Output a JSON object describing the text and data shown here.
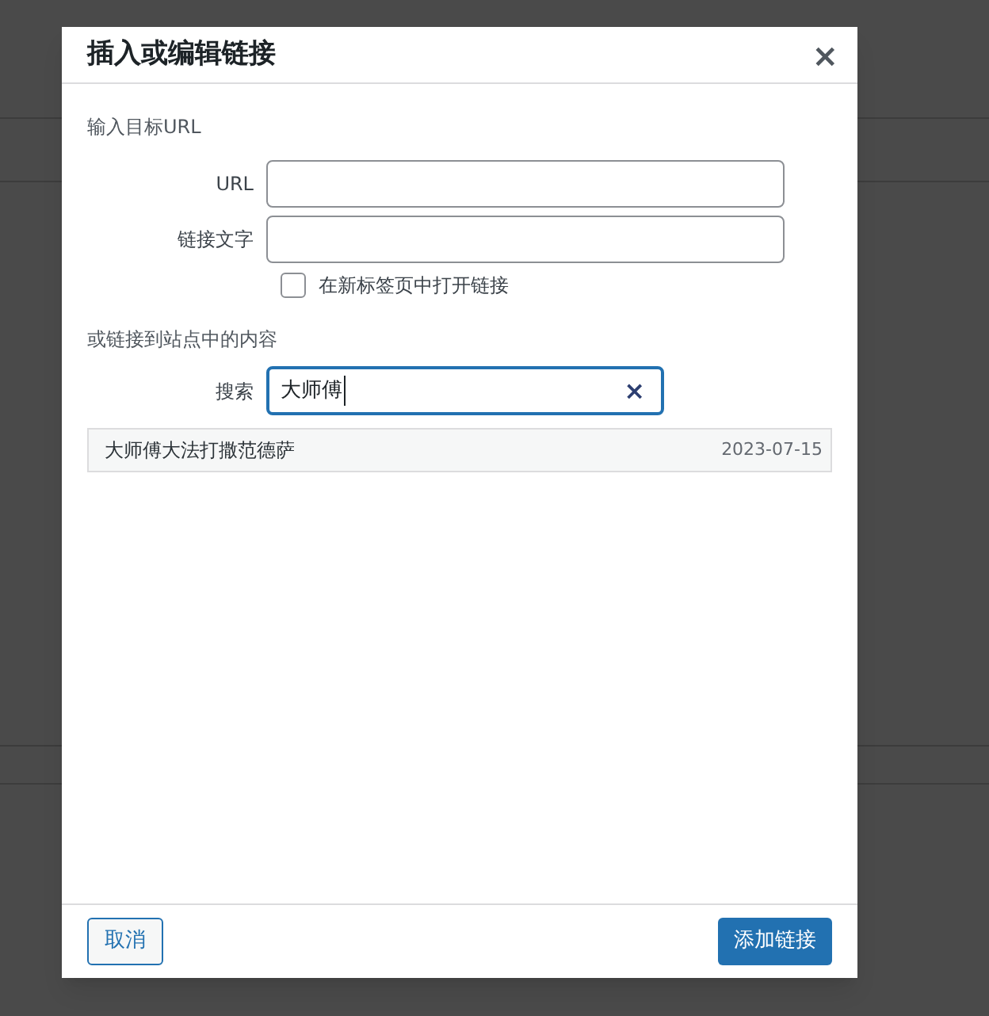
{
  "dialog": {
    "title": "插入或编辑链接",
    "close": "×"
  },
  "url_section": {
    "heading": "输入目标URL",
    "url_label": "URL",
    "text_label": "链接文字",
    "new_tab": {
      "label": "在新标签页中打开链接",
      "checked": false
    }
  },
  "link_section": {
    "heading": "或链接到站点中的内容",
    "search_label": "搜索",
    "search_value": "大师傅",
    "clear": "×",
    "results": [
      {
        "title": "大师傅大法打撒范德萨",
        "date": "2023-07-15",
        "selected": false
      }
    ]
  },
  "buttons": {
    "cancel": "取消",
    "submit": "添加链接"
  }
}
